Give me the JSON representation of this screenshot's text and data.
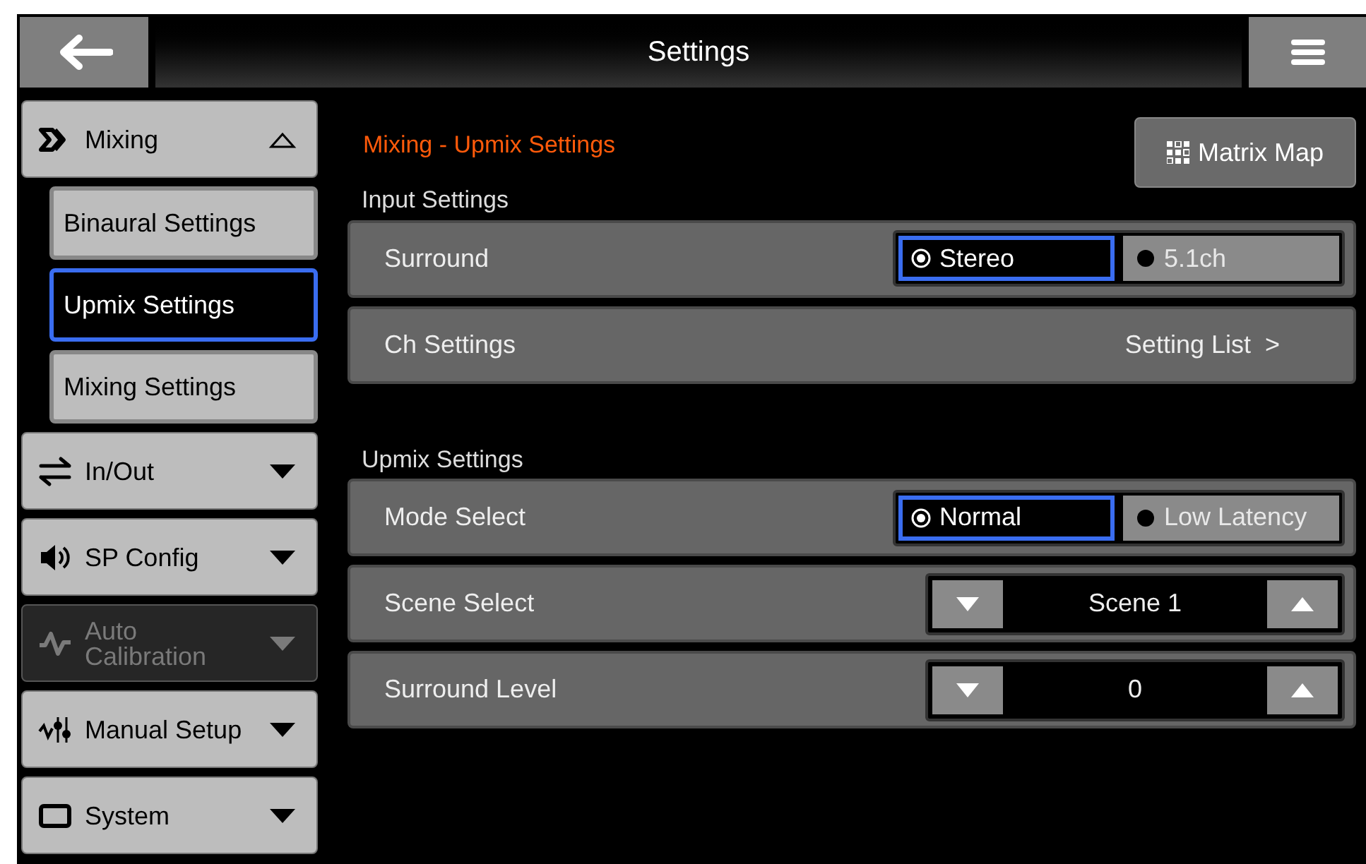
{
  "header": {
    "title": "Settings"
  },
  "sidebar": {
    "items": [
      {
        "label": "Mixing",
        "expanded": true,
        "disabled": false,
        "children": [
          {
            "label": "Binaural Settings",
            "selected": false
          },
          {
            "label": "Upmix Settings",
            "selected": true
          },
          {
            "label": "Mixing Settings",
            "selected": false
          }
        ]
      },
      {
        "label": "In/Out",
        "expanded": false,
        "disabled": false
      },
      {
        "label": "SP Config",
        "expanded": false,
        "disabled": false
      },
      {
        "label": "Auto Calibration",
        "expanded": false,
        "disabled": true
      },
      {
        "label": "Manual Setup",
        "expanded": false,
        "disabled": false
      },
      {
        "label": "System",
        "expanded": false,
        "disabled": false
      }
    ]
  },
  "content": {
    "breadcrumb": "Mixing - Upmix Settings",
    "matrix_button": "Matrix Map",
    "sections": [
      {
        "title": "Input Settings",
        "rows": [
          {
            "kind": "radio",
            "label": "Surround",
            "options": [
              {
                "label": "Stereo",
                "selected": true
              },
              {
                "label": "5.1ch",
                "selected": false
              }
            ]
          },
          {
            "kind": "link",
            "label": "Ch Settings",
            "value": "Setting List  >"
          }
        ]
      },
      {
        "title": "Upmix Settings",
        "rows": [
          {
            "kind": "radio",
            "label": "Mode Select",
            "options": [
              {
                "label": "Normal",
                "selected": true
              },
              {
                "label": "Low Latency",
                "selected": false
              }
            ]
          },
          {
            "kind": "stepper",
            "label": "Scene Select",
            "value": "Scene 1"
          },
          {
            "kind": "stepper",
            "label": "Surround Level",
            "value": "0"
          }
        ]
      }
    ]
  }
}
